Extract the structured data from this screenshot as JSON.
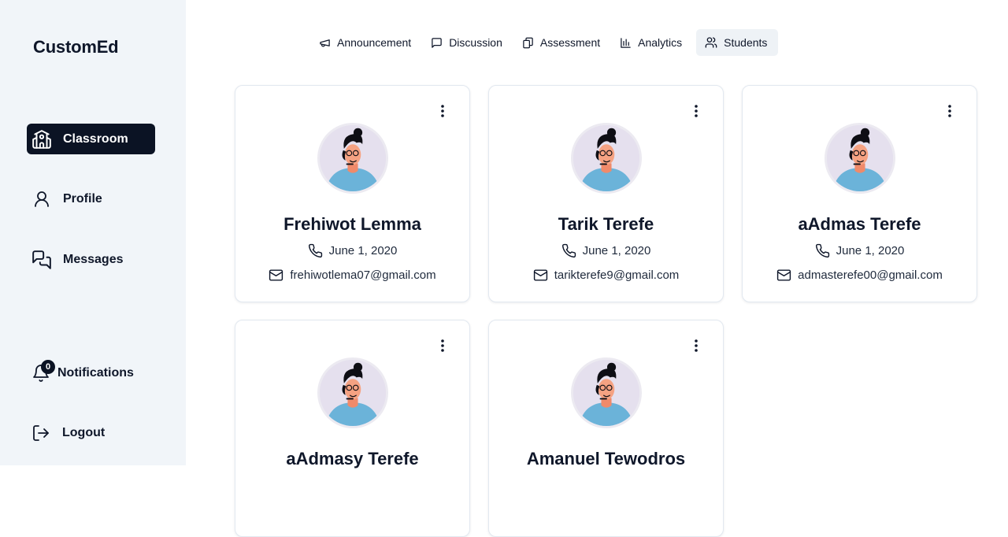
{
  "brand": "CustomEd",
  "sidebar": {
    "items": [
      {
        "label": "Classroom",
        "icon": "school-icon",
        "active": true
      },
      {
        "label": "Profile",
        "icon": "user-icon"
      },
      {
        "label": "Messages",
        "icon": "messages-icon"
      }
    ],
    "notifications": {
      "label": "Notifications",
      "count": "0",
      "icon": "bell-icon"
    },
    "logout": {
      "label": "Logout",
      "icon": "logout-icon"
    }
  },
  "tabs": [
    {
      "label": "Announcement",
      "icon": "megaphone-icon"
    },
    {
      "label": "Discussion",
      "icon": "message-square-icon"
    },
    {
      "label": "Assessment",
      "icon": "copy-icon"
    },
    {
      "label": "Analytics",
      "icon": "bar-chart-icon"
    },
    {
      "label": "Students",
      "icon": "users-icon",
      "active": true
    }
  ],
  "students": [
    {
      "name": "Frehiwot Lemma",
      "phone": "June 1, 2020",
      "email": "frehiwotlema07@gmail.com"
    },
    {
      "name": "Tarik Terefe",
      "phone": "June 1, 2020",
      "email": "tarikterefe9@gmail.com"
    },
    {
      "name": "aAdmas Terefe",
      "phone": "June 1, 2020",
      "email": "admasterefe00@gmail.com"
    },
    {
      "name": "aAdmasy Terefe",
      "phone": "",
      "email": ""
    },
    {
      "name": "Amanuel Tewodros",
      "phone": "",
      "email": ""
    }
  ],
  "colors": {
    "accent": "#0b1324",
    "sidebar_bg": "#f1f5f9",
    "avatar_bg": "#e5e0ee",
    "shirt": "#6bb3d9"
  }
}
